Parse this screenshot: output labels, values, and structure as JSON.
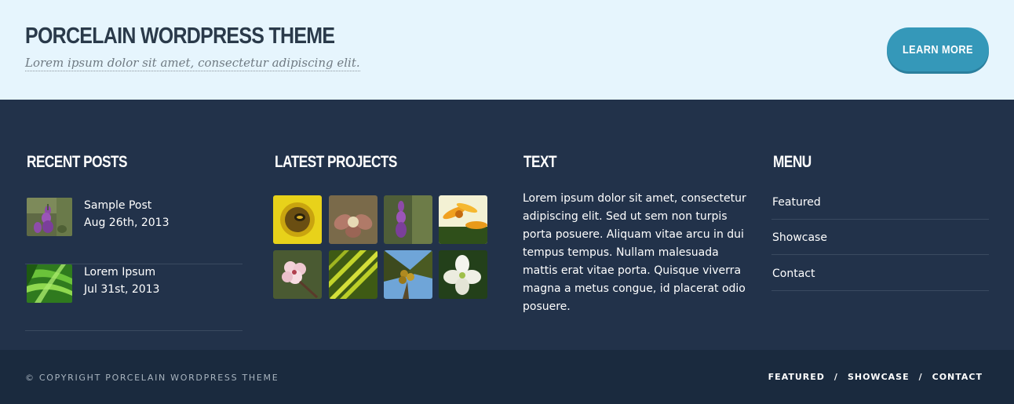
{
  "banner": {
    "title": "PORCELAIN WORDPRESS THEME",
    "subtitle": "Lorem ipsum dolor sit amet, consectetur adipiscing elit.",
    "button_label": "LEARN MORE"
  },
  "widgets": {
    "recent_posts": {
      "title": "RECENT POSTS",
      "posts": [
        {
          "title": "Sample Post",
          "date": "Aug 26th, 2013",
          "thumb": "purple-lupine-flower-icon"
        },
        {
          "title": "Lorem Ipsum",
          "date": "Jul 31st, 2013",
          "thumb": "green-leaves-icon"
        }
      ]
    },
    "latest_projects": {
      "title": "LATEST PROJECTS",
      "thumbs": [
        "sunflower-bee",
        "brown-flower-bud",
        "purple-lupine",
        "orange-daisies",
        "pink-cherry-blossom",
        "yellow-palm-leaf",
        "palm-tree-coconuts",
        "white-dogwood"
      ]
    },
    "text": {
      "title": "TEXT",
      "body": "Lorem ipsum dolor sit amet, consectetur adipiscing elit. Sed ut sem non turpis porta posuere. Aliquam vitae arcu in dui tempus tempus. Nullam malesuada mattis erat vitae porta. Quisque viverra magna a metus congue, id placerat odio posuere."
    },
    "menu": {
      "title": "MENU",
      "items": [
        "Featured",
        "Showcase",
        "Contact"
      ]
    }
  },
  "footer": {
    "copyright": "© COPYRIGHT PORCELAIN WORDPRESS THEME",
    "nav": [
      "FEATURED",
      "SHOWCASE",
      "CONTACT"
    ],
    "separator": "/"
  },
  "colors": {
    "banner_bg": "#e6f5fd",
    "widgets_bg": "#22324a",
    "footer_bg": "#1a2a3e",
    "accent": "#3598b9"
  }
}
